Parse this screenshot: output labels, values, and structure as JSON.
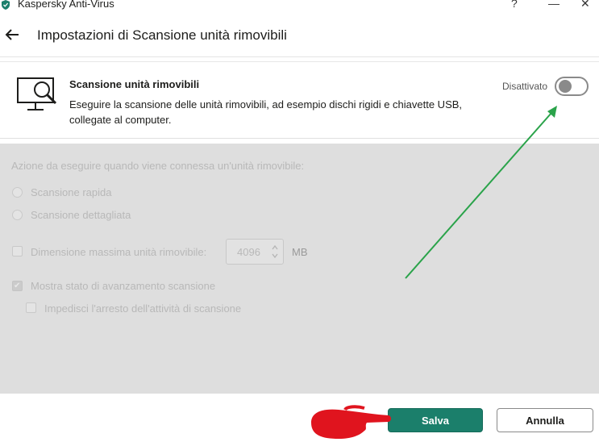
{
  "window": {
    "title": "Kaspersky Anti-Virus",
    "help_label": "?",
    "minimize_label": "—",
    "close_label": "✕"
  },
  "header": {
    "title": "Impostazioni di Scansione unità rimovibili"
  },
  "feature": {
    "title": "Scansione unità rimovibili",
    "description": "Eseguire la scansione delle unità rimovibili, ad esempio dischi rigidi e chiavette USB, collegate al computer.",
    "status_label": "Disattivato",
    "enabled": false
  },
  "options": {
    "action_label": "Azione da eseguire quando viene connessa un'unità rimovibile:",
    "radio_quick": "Scansione rapida",
    "radio_full": "Scansione dettagliata",
    "max_size_label": "Dimensione massima unità rimovibile:",
    "max_size_value": "4096",
    "max_size_unit": "MB",
    "show_progress_label": "Mostra stato di avanzamento scansione",
    "show_progress_checked": true,
    "prevent_stop_label": "Impedisci l'arresto dell'attività di scansione",
    "prevent_stop_checked": false
  },
  "footer": {
    "save_label": "Salva",
    "cancel_label": "Annulla"
  },
  "colors": {
    "accent": "#1b7f6b",
    "annotation_arrow": "#2aa34a",
    "annotation_hand": "#e0141e",
    "disabled_panel": "#dedede"
  }
}
